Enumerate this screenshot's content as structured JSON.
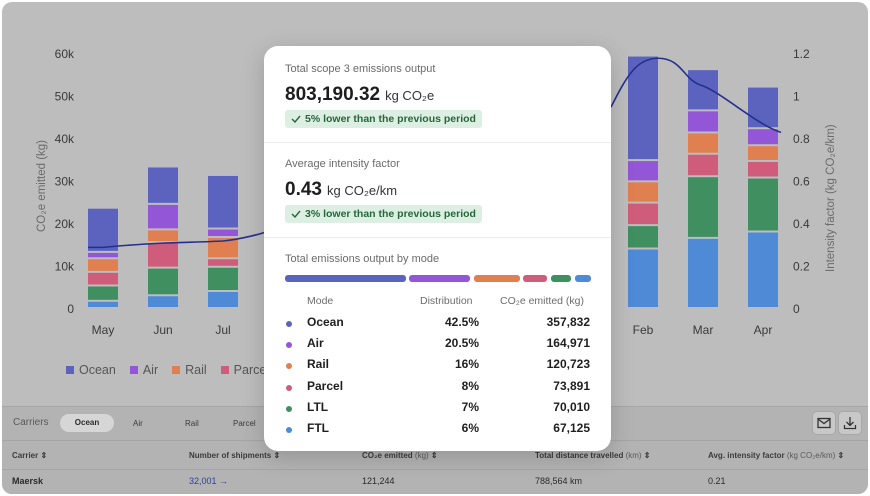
{
  "chart_data": {
    "type": "bar",
    "stacked": true,
    "categories": [
      "May",
      "Jun",
      "Jul",
      "Feb",
      "Mar",
      "Apr"
    ],
    "ylim": [
      0,
      60000
    ],
    "y_ticks": [
      "0",
      "10k",
      "20k",
      "30k",
      "40k",
      "50k",
      "60k"
    ],
    "y2_ticks": [
      "0",
      "0.2",
      "0.4",
      "0.6",
      "0.8",
      "1",
      "1.2"
    ],
    "ylabel": "CO₂e emitted (kg)",
    "y2label": "Intensity factor (kg CO₂e/km)",
    "y2lim": [
      0,
      1.2
    ],
    "series": [
      {
        "name": "FTL",
        "color": "#4f8ad6",
        "values": [
          1700,
          3000,
          4000,
          14000,
          16500,
          18000
        ]
      },
      {
        "name": "LTL",
        "color": "#3f8f61",
        "values": [
          3600,
          6500,
          5700,
          5500,
          14500,
          12700
        ]
      },
      {
        "name": "Parcel",
        "color": "#cf5c7a",
        "values": [
          3200,
          6000,
          2000,
          5300,
          5300,
          3900
        ]
      },
      {
        "name": "Rail",
        "color": "#e07f4f",
        "values": [
          3200,
          3000,
          5000,
          5000,
          5000,
          3700
        ]
      },
      {
        "name": "Air",
        "color": "#9356d6",
        "values": [
          1500,
          6000,
          2000,
          5000,
          5200,
          4000
        ]
      },
      {
        "name": "Ocean",
        "color": "#5b63be",
        "values": [
          10400,
          8800,
          12600,
          24600,
          9700,
          9800
        ]
      }
    ],
    "intensity_line": {
      "color": "#24308f",
      "points": [
        [
          0,
          0.29
        ],
        [
          1,
          0.31
        ],
        [
          2,
          0.32
        ],
        [
          3,
          1.18
        ],
        [
          4,
          1.05
        ],
        [
          5,
          0.85
        ]
      ]
    },
    "legend_position": "bottom-left",
    "grid": false
  },
  "legend": [
    {
      "label": "Ocean",
      "color": "#5b63be"
    },
    {
      "label": "Air",
      "color": "#9356d6"
    },
    {
      "label": "Rail",
      "color": "#e07f4f"
    },
    {
      "label": "Parcel",
      "color": "#cf5c7a"
    }
  ],
  "card": {
    "total_title": "Total scope 3 emissions output",
    "total_value": "803,190.32",
    "total_unit": "kg CO₂e",
    "total_badge": "5% lower than the previous period",
    "intensity_title": "Average intensity factor",
    "intensity_value": "0.43",
    "intensity_unit": "kg CO₂e/km",
    "intensity_badge": "3% lower than the previous period",
    "mode_title": "Total emissions output by mode",
    "mode_bar_colors": [
      "#5b63be",
      "#9356d6",
      "#e07f4f",
      "#cf5c7a",
      "#3f8f61",
      "#4f8ad6"
    ],
    "headers": {
      "mode": "Mode",
      "distribution": "Distribution",
      "emitted": "CO₂e emitted (kg)"
    },
    "rows": [
      {
        "mode": "Ocean",
        "distribution": "42.5%",
        "emitted": "357,832",
        "color": "#5b63be"
      },
      {
        "mode": "Air",
        "distribution": "20.5%",
        "emitted": "164,971",
        "color": "#9356d6"
      },
      {
        "mode": "Rail",
        "distribution": "16%",
        "emitted": "120,723",
        "color": "#e07f4f"
      },
      {
        "mode": "Parcel",
        "distribution": "8%",
        "emitted": "73,891",
        "color": "#cf5c7a"
      },
      {
        "mode": "LTL",
        "distribution": "7%",
        "emitted": "70,010",
        "color": "#3f8f61"
      },
      {
        "mode": "FTL",
        "distribution": "6%",
        "emitted": "67,125",
        "color": "#4f8ad6"
      }
    ]
  },
  "carriers": {
    "label": "Carriers",
    "filters": [
      "Ocean",
      "Air",
      "Rail",
      "Parcel"
    ],
    "columns": {
      "carrier": "Carrier",
      "shipments": "Number of shipments",
      "emitted": "CO₂e emitted",
      "emitted_unit": "(kg)",
      "distance": "Total distance travelled",
      "distance_unit": "(km)",
      "intensity": "Avg. intensity factor",
      "intensity_unit": "(kg CO₂e/km)"
    },
    "row": {
      "carrier": "Maersk",
      "shipments": "32,001",
      "emitted": "121,244",
      "distance": "788,564 km",
      "intensity": "0.21"
    }
  }
}
